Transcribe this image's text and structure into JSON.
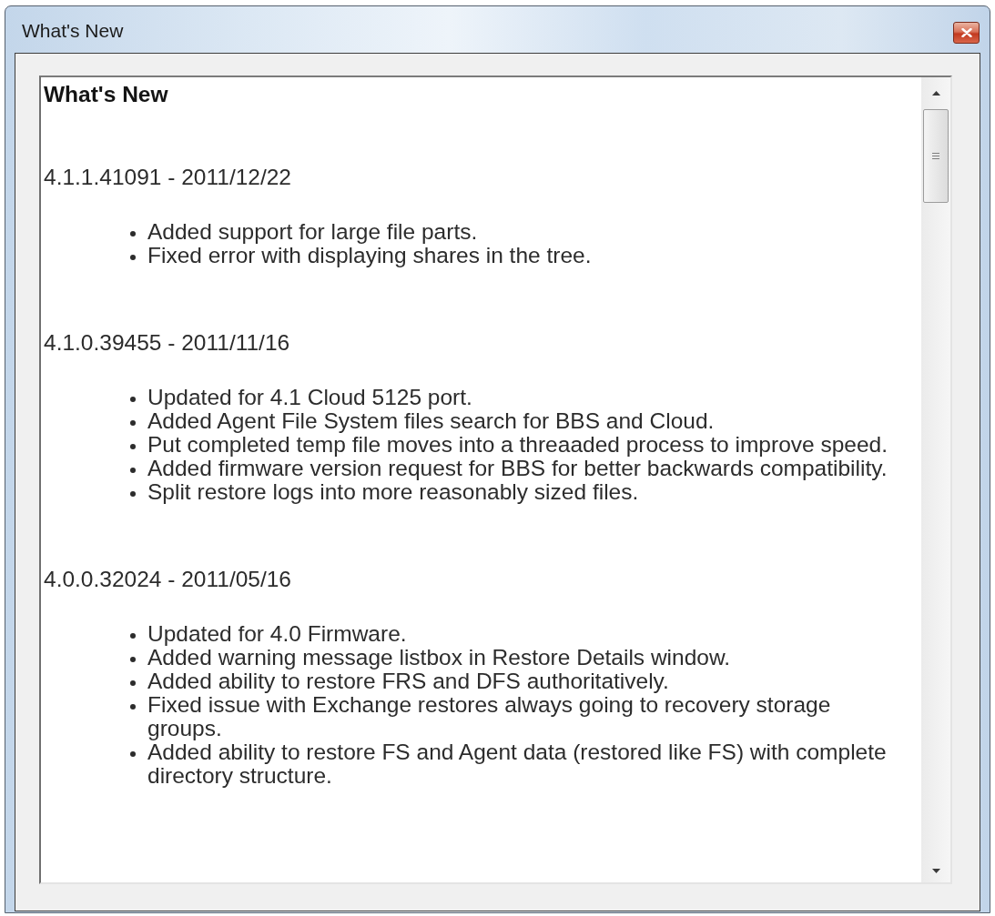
{
  "window": {
    "title": "What's New"
  },
  "document": {
    "heading": "What's New",
    "releases": [
      {
        "version": "4.1.1.41091 - 2011/12/22",
        "notes": [
          "Added support for large file parts.",
          "Fixed error with displaying shares in the tree."
        ]
      },
      {
        "version": "4.1.0.39455 - 2011/11/16",
        "notes": [
          "Updated for 4.1 Cloud 5125 port.",
          "Added Agent File System files search for BBS and Cloud.",
          "Put completed temp file moves into a threaaded process to improve speed.",
          "Added firmware version request for BBS for better backwards compatibility.",
          "Split restore logs into more reasonably sized files."
        ]
      },
      {
        "version": "4.0.0.32024 - 2011/05/16",
        "notes": [
          "Updated for 4.0 Firmware.",
          "Added warning message listbox in Restore Details window.",
          "Added ability to restore FRS and DFS authoritatively.",
          "Fixed issue with Exchange restores always going to recovery storage groups.",
          "Added ability to restore FS and Agent data (restored like FS) with complete directory structure."
        ]
      }
    ]
  }
}
